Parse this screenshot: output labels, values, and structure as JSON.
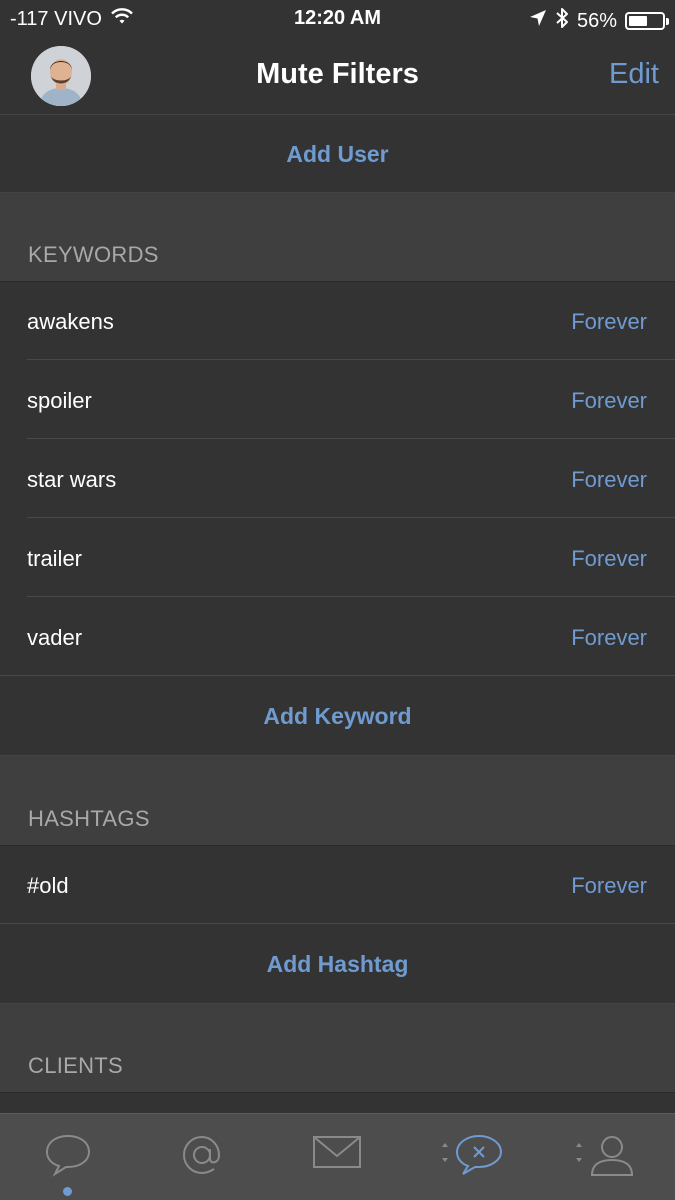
{
  "status_bar": {
    "carrier": "-117 VIVO",
    "time": "12:20 AM",
    "battery_percent": "56%",
    "battery_level": 0.56,
    "icons": [
      "wifi-icon",
      "location-arrow-icon",
      "bluetooth-icon",
      "battery-icon"
    ]
  },
  "nav": {
    "title": "Mute Filters",
    "edit_label": "Edit"
  },
  "users": {
    "add_label": "Add User"
  },
  "keywords": {
    "header": "KEYWORDS",
    "items": [
      {
        "keyword": "awakens",
        "duration": "Forever"
      },
      {
        "keyword": "spoiler",
        "duration": "Forever"
      },
      {
        "keyword": "star wars",
        "duration": "Forever"
      },
      {
        "keyword": "trailer",
        "duration": "Forever"
      },
      {
        "keyword": "vader",
        "duration": "Forever"
      }
    ],
    "add_label": "Add Keyword"
  },
  "hashtags": {
    "header": "HASHTAGS",
    "items": [
      {
        "keyword": "#old",
        "duration": "Forever"
      }
    ],
    "add_label": "Add Hashtag"
  },
  "clients": {
    "header": "CLIENTS"
  },
  "tab_bar": {
    "tabs": [
      {
        "icon": "speech-bubble-icon",
        "active": true
      },
      {
        "icon": "at-sign-icon",
        "active": false
      },
      {
        "icon": "envelope-icon",
        "active": false
      },
      {
        "icon": "mute-bubble-icon",
        "active": false,
        "selected": true
      },
      {
        "icon": "profile-icon",
        "active": false
      }
    ]
  },
  "colors": {
    "accent": "#6f9bd1",
    "background": "#333333",
    "section_header_bg": "#3f3f3f",
    "tab_bar_bg": "#4d4d4d"
  }
}
